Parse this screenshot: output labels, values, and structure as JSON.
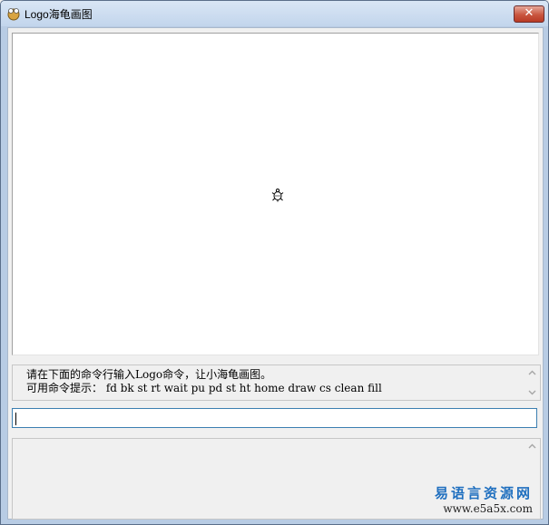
{
  "window": {
    "title": "Logo海龟画图",
    "close_label": "✕"
  },
  "hint": {
    "line1": "请在下面的命令行输入Logo命令，让小海龟画图。",
    "line2": "可用命令提示： fd bk st rt wait pu pd st ht home draw cs clean fill"
  },
  "command_input": {
    "value": ""
  },
  "watermark": {
    "name": "易语言资源网",
    "url": "www.e5a5x.com"
  },
  "colors": {
    "titlebar": "#c2d5ec",
    "close_button": "#c9563f",
    "input_border": "#3c7fb1",
    "watermark_blue": "#1f6fbf"
  }
}
